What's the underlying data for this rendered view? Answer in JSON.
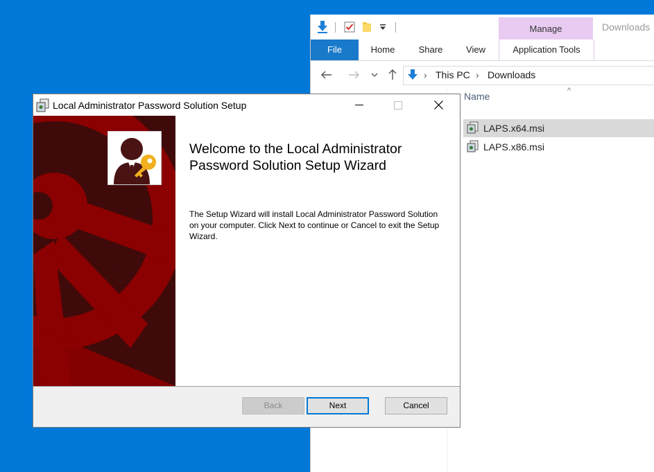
{
  "explorer": {
    "window_title": "Downloads",
    "qat": {
      "icons": [
        "download-icon",
        "properties-check-icon",
        "new-folder-icon",
        "customize-dropdown-icon"
      ]
    },
    "contextual_group": "Manage",
    "tabs": {
      "file": "File",
      "home": "Home",
      "share": "Share",
      "view": "View",
      "application_tools": "Application Tools"
    },
    "breadcrumb": [
      "This PC",
      "Downloads"
    ],
    "column_name": "Name",
    "files": [
      {
        "name": "LAPS.x64.msi",
        "selected": true
      },
      {
        "name": "LAPS.x86.msi",
        "selected": false
      }
    ]
  },
  "dialog": {
    "title": "Local Administrator Password Solution Setup",
    "welcome_heading": "Welcome to the Local Administrator Password Solution Setup Wizard",
    "description": "The Setup Wizard will install Local Administrator Password Solution on your computer. Click Next to continue or Cancel to exit the Setup Wizard.",
    "buttons": {
      "back": "Back",
      "next": "Next",
      "cancel": "Cancel"
    },
    "back_enabled": false
  },
  "colors": {
    "desktop": "#0078d7",
    "banner_red": "#8b0000",
    "banner_dark": "#3a0808",
    "manage_tab": "#e9cbf2",
    "file_tab": "#1979ca",
    "key_gold": "#f2b01e"
  }
}
